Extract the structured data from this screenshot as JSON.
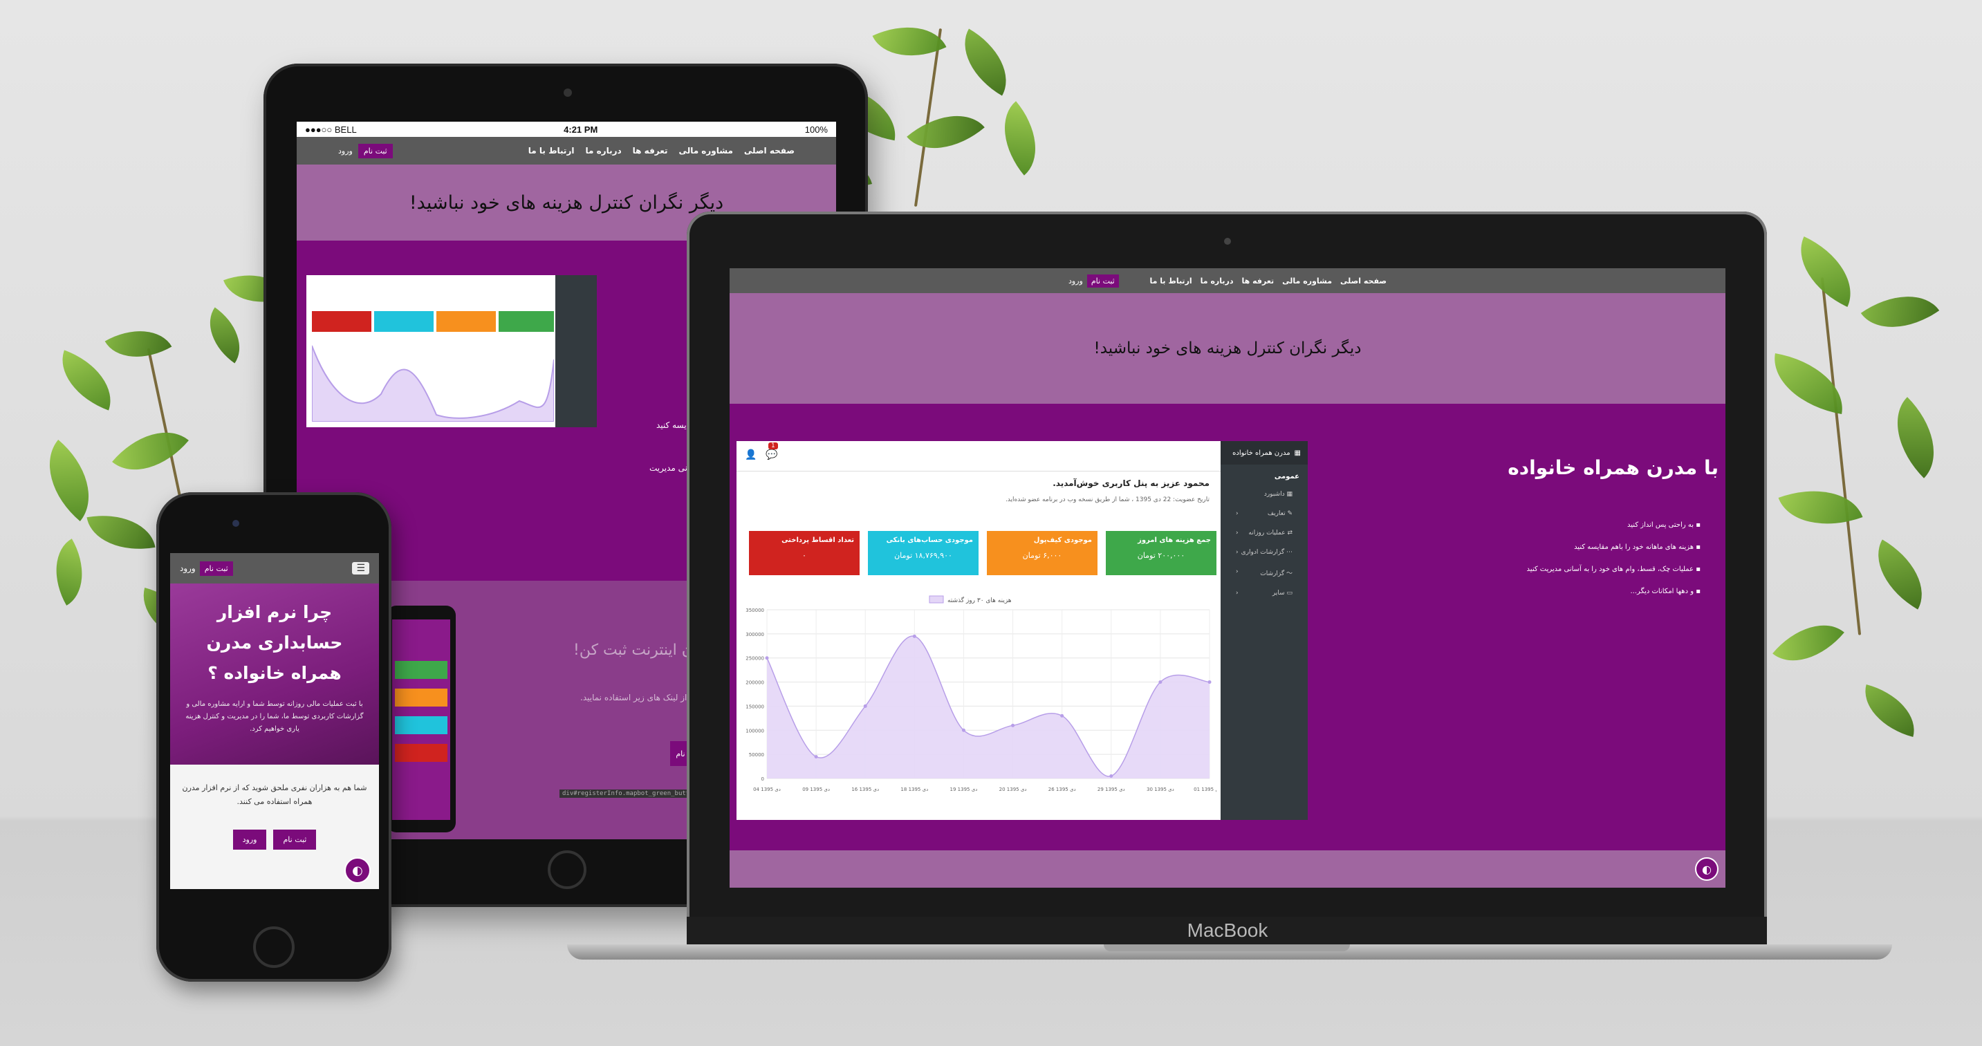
{
  "site": {
    "nav": {
      "home": "صفحه اصلی",
      "advice": "مشاوره مالی",
      "tariffs": "تعرفه ها",
      "about": "درباره ما",
      "contact": "ارتباط با ما",
      "signup": "ثبت نام",
      "login": "ورود"
    },
    "hero_title": "دیگر نگران کنترل هزینه های خود نباشید!"
  },
  "tablet": {
    "statusbar": {
      "carrier": "●●●○○ BELL",
      "time": "4:21 PM",
      "battery": "100%"
    },
    "fragment_1": "مقایسه کنید",
    "fragment_2": "اسانی مدیریت",
    "section2_title": "ون اینترنت ثبت کن!",
    "section2_text": "از لینک های زیر استفاده نمایید.",
    "section2_button": "نام",
    "debug_text": "div#registerInfo.mapbot_green_button_mapbot"
  },
  "laptop": {
    "label": "MacBook",
    "feature_title": "با مدرن همراه خانواده",
    "features": [
      "به راحتی پس انداز کنید",
      "هزینه های ماهانه خود را باهم مقایسه کنید",
      "عملیات چک، قسط، وام های خود را به آسانی مدیریت کنید",
      "و دهها امکانات دیگر..."
    ],
    "dashboard": {
      "brand": "مدرن همراه خانواده",
      "notif_count": "1",
      "welcome": "محمود عزیز به پنل کاربری خوش‌آمدید.",
      "member_since": "تاریخ عضویت: 22 دی 1395 ، شما از طریق نسخه وب در برنامه عضو شده‌اید.",
      "sidebar_header": "عمومی",
      "sidebar_items": [
        "داشبورد",
        "تعاریف",
        "عملیات روزانه",
        "گزارشات ادواری",
        "گزارشات",
        "سایر"
      ],
      "cards": [
        {
          "title": "جمع هزینه های امروز",
          "value": "۲۰۰,۰۰۰ تومان",
          "color": "#3ea84a"
        },
        {
          "title": "موجودی کیف‌پول",
          "value": "۶,۰۰۰ تومان",
          "color": "#f7901e"
        },
        {
          "title": "موجودی حساب‌های بانکی",
          "value": "۱۸,۷۶۹,۹۰۰ تومان",
          "color": "#20c3dc"
        },
        {
          "title": "تعداد اقساط پرداختی",
          "value": "۰",
          "color": "#d0231f"
        }
      ]
    }
  },
  "phone": {
    "title": "چرا نرم افزار حسابداری مدرن همراه خانواده ؟",
    "description": "با ثبت عملیات مالی روزانه توسط شما و ارایه مشاوره مالی و گزارشات کاربردی توسط ما، شما را در مدیریت و کنترل هزینه یاری خواهیم کرد.",
    "cta_text": "شما هم به هزاران نفری ملحق شوید که از نرم افزار مدرن همراه استفاده می کنند.",
    "signup": "ثبت نام",
    "login": "ورود"
  },
  "chart_data": {
    "type": "area",
    "legend": [
      "هزینه های ۳۰ روز گذشته"
    ],
    "x": [
      "04 دی 1395",
      "09 دی 1395",
      "16 دی 1395",
      "18 دی 1395",
      "19 دی 1395",
      "20 دی 1395",
      "26 دی 1395",
      "29 دی 1395",
      "30 دی 1395",
      "01 بهمن 1395"
    ],
    "values": [
      250000,
      45000,
      150000,
      295000,
      100000,
      110000,
      130000,
      5000,
      200000,
      200000
    ],
    "ylim": [
      0,
      350000
    ],
    "yticks": [
      0,
      50000,
      100000,
      150000,
      200000,
      250000,
      300000,
      350000
    ],
    "color": "#b79ee8"
  }
}
